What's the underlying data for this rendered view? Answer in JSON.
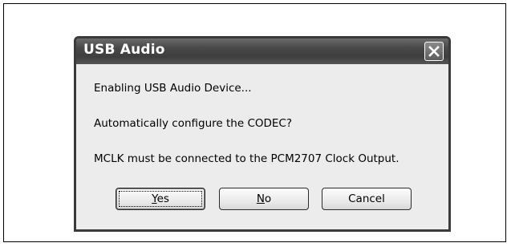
{
  "dialog": {
    "title": "USB Audio",
    "messages": [
      "Enabling USB Audio Device...",
      "Automatically configure the CODEC?",
      "MCLK must be connected to the PCM2707 Clock Output."
    ],
    "buttons": {
      "yes": {
        "mnemonic": "Y",
        "rest": "es"
      },
      "no": {
        "mnemonic": "N",
        "rest": "o"
      },
      "cancel": {
        "label": "Cancel"
      }
    }
  },
  "icons": {
    "close": "close-icon"
  }
}
